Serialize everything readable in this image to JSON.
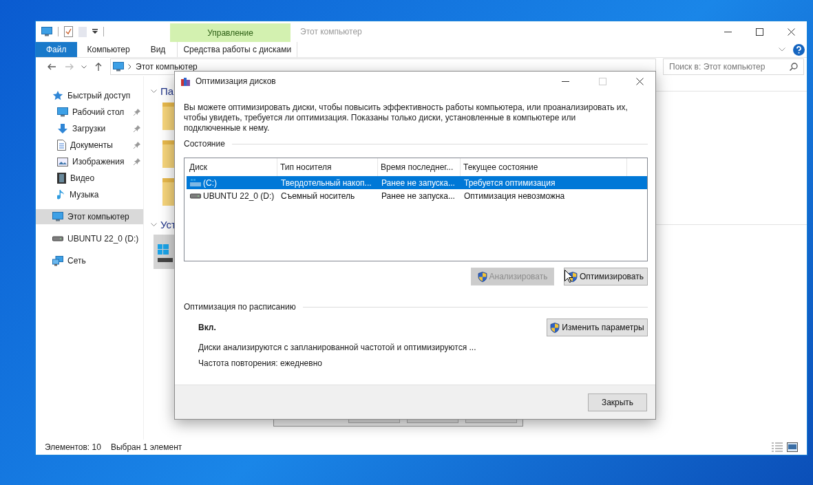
{
  "explorer": {
    "context_group": "Управление",
    "title": "Этот компьютер",
    "ribbon_tabs": [
      {
        "label": "Файл",
        "selected": true
      },
      {
        "label": "Компьютер",
        "selected": false
      },
      {
        "label": "Вид",
        "selected": false
      },
      {
        "label": "Средства работы с дисками",
        "selected": false
      }
    ],
    "address": "Этот компьютер",
    "search_placeholder": "Поиск в: Этот компьютер",
    "nav": [
      {
        "label": "Быстрый доступ",
        "selected": false,
        "children": [
          {
            "label": "Рабочий стол",
            "pinned": true,
            "selected": false
          },
          {
            "label": "Загрузки",
            "pinned": true,
            "selected": false
          },
          {
            "label": "Документы",
            "pinned": true,
            "selected": false
          },
          {
            "label": "Изображения",
            "pinned": true,
            "selected": false
          },
          {
            "label": "Видео",
            "pinned": false,
            "selected": false
          },
          {
            "label": "Музыка",
            "pinned": false,
            "selected": false
          }
        ]
      },
      {
        "label": "Этот компьютер",
        "selected": true
      },
      {
        "label": "UBUNTU 22_0 (D:)",
        "selected": false
      },
      {
        "label": "Сеть",
        "selected": false
      }
    ],
    "sections": [
      "Па",
      "Уст"
    ],
    "status": [
      "Элементов: 10",
      "Выбран 1 элемент"
    ]
  },
  "dialog": {
    "title": "Оптимизация дисков",
    "description": "Вы можете оптимизировать диски, чтобы повысить эффективность работы  компьютера, или проанализировать их, чтобы увидеть, требуется ли оптимизация. Показаны только диски, установленные в компьютере или подключенные к нему.",
    "status_heading": "Состояние",
    "columns": [
      "Диск",
      "Тип носителя",
      "Время последнег...",
      "Текущее состояние"
    ],
    "rows": [
      {
        "cells": [
          "(C:)",
          "Твердотельный накоп...",
          "Ранее не запуска...",
          "Требуется оптимизация"
        ],
        "selected": true
      },
      {
        "cells": [
          "UBUNTU 22_0 (D:)",
          "Съемный носитель",
          "Ранее не запуска...",
          "Оптимизация невозможна"
        ],
        "selected": false
      }
    ],
    "actions": [
      {
        "label": "Анализировать",
        "disabled": true
      },
      {
        "label": "Оптимизировать",
        "disabled": false
      }
    ],
    "schedule": {
      "heading": "Оптимизация по расписанию",
      "state": "Вкл.",
      "description": "Диски анализируются с запланированной частотой и оптимизируются ...",
      "frequency": "Частота повторения: ежедневно",
      "button": "Изменить параметры"
    },
    "close_button": "Закрыть"
  }
}
